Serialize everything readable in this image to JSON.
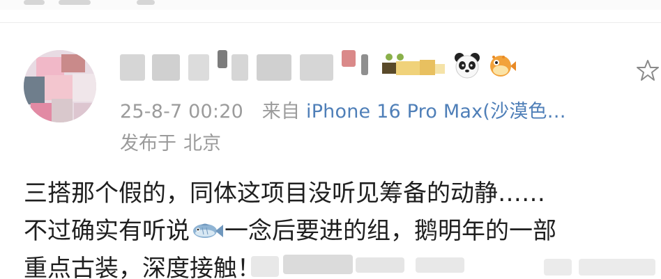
{
  "post": {
    "meta": {
      "date": "25-8-7 00:20",
      "from_label": "来自",
      "device": "iPhone 16 Pro Max(沙漠色…",
      "location_label": "发布于",
      "location": "北京"
    },
    "body_lines": [
      "三搭那个假的，同体这项目没听见筹备的动静……",
      "不过确实有听说",
      "一念后要进的组，鹅明年的一部",
      "重点古装，深度接触！"
    ]
  },
  "icons": {
    "panda": "panda-emoji-icon",
    "pufferfish": "pufferfish-emoji-icon",
    "fish": "fish-emoji-icon",
    "star": "star-outline-icon"
  },
  "colors": {
    "meta_gray": "#9b9b9b",
    "device_link": "#4f7fb8",
    "body_text": "#1f1f1f"
  }
}
